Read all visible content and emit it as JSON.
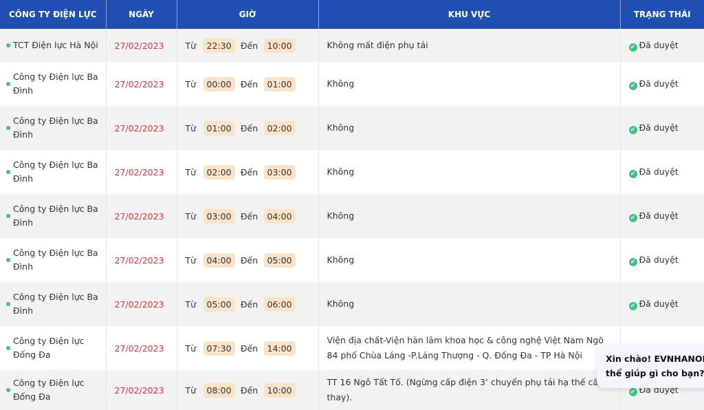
{
  "headers": [
    "CÔNG TY ĐIỆN LỰC",
    "NGÀY",
    "GIỜ",
    "KHU VỰC",
    "TRẠNG THÁI"
  ],
  "labels": {
    "from": "Từ",
    "to": "Đến"
  },
  "rows": [
    {
      "company": "TCT Điện lực Hà Nội",
      "date": "27/02/2023",
      "from": "22:30",
      "to": "10:00",
      "area": "Không mất điện phụ tải",
      "status": "Đã duyệt"
    },
    {
      "company": "Công ty Điện lực Ba Đình",
      "date": "27/02/2023",
      "from": "00:00",
      "to": "01:00",
      "area": "Không",
      "status": "Đã duyệt"
    },
    {
      "company": "Công ty Điện lực Ba Đình",
      "date": "27/02/2023",
      "from": "01:00",
      "to": "02:00",
      "area": "Không",
      "status": "Đã duyệt"
    },
    {
      "company": "Công ty Điện lực Ba Đình",
      "date": "27/02/2023",
      "from": "02:00",
      "to": "03:00",
      "area": "Không",
      "status": "Đã duyệt"
    },
    {
      "company": "Công ty Điện lực Ba Đình",
      "date": "27/02/2023",
      "from": "03:00",
      "to": "04:00",
      "area": "Không",
      "status": "Đã duyệt"
    },
    {
      "company": "Công ty Điện lực Ba Đình",
      "date": "27/02/2023",
      "from": "04:00",
      "to": "05:00",
      "area": "Không",
      "status": "Đã duyệt"
    },
    {
      "company": "Công ty Điện lực Ba Đình",
      "date": "27/02/2023",
      "from": "05:00",
      "to": "06:00",
      "area": "Không",
      "status": "Đã duyệt"
    },
    {
      "company": "Công ty Điện lực Đống Đa",
      "date": "27/02/2023",
      "from": "07:30",
      "to": "14:00",
      "area": "Viện địa chất-Viện hàn lâm khoa học & công nghệ Việt Nam Ngõ 84 phố Chùa Láng -P.Láng Thượng - Q. Đống Đa - TP Hà Nội",
      "status": ""
    },
    {
      "company": "Công ty Điện lực Đống Đa",
      "date": "27/02/2023",
      "from": "08:00",
      "to": "10:00",
      "area": "TT 16 Ngô Tất Tố. (Ngừng cấp điện 3’ chuyển phụ tải hạ thế cấp thay).",
      "status": "Đã duyệt"
    }
  ],
  "chat": {
    "line1": "Xin chào! EVNHANOI có",
    "line2": "thể giúp gì cho bạn?"
  },
  "colors": {
    "header": "#1f4fb2",
    "date": "#d9363e",
    "pill": "#fbe3c6",
    "status": "#3cc47c"
  }
}
